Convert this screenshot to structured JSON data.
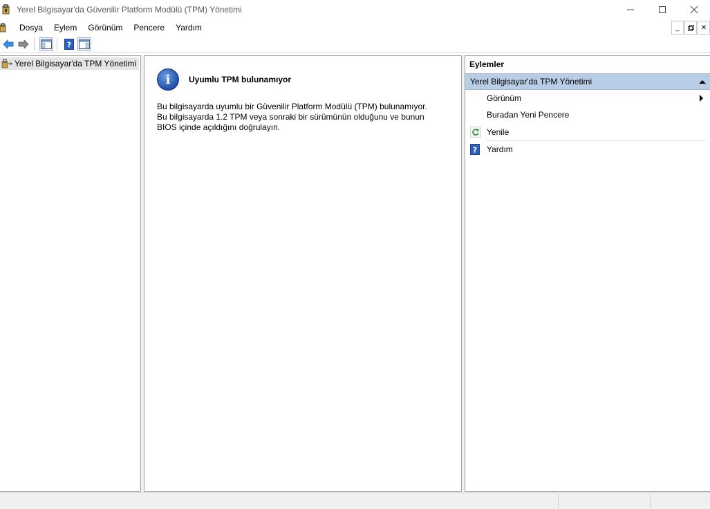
{
  "window": {
    "title": "Yerel Bilgisayar'da Güvenilir Platform Modülü (TPM) Yönetimi",
    "minimize": "—",
    "maximize": "☐",
    "close": "✕"
  },
  "menubar": {
    "items": [
      "Dosya",
      "Eylem",
      "Görünüm",
      "Pencere",
      "Yardım"
    ],
    "mdi_minimize": "_",
    "mdi_restore": "🗗",
    "mdi_close": "✕"
  },
  "toolbar": {
    "icons": [
      "back-arrow-icon",
      "forward-arrow-icon",
      "show-hide-console-tree-icon",
      "help-icon",
      "show-hide-action-pane-icon"
    ]
  },
  "tree": {
    "root_label": "Yerel Bilgisayar'da TPM Yönetimi"
  },
  "center": {
    "heading": "Uyumlu TPM bulunamıyor",
    "body_line1": "Bu bilgisayarda uyumlu bir Güvenilir Platform Modülü (TPM) bulunamıyor.",
    "body_line2": "Bu bilgisayarda 1.2 TPM veya sonraki bir sürümünün olduğunu ve bunun",
    "body_line3": "BIOS içinde açıldığını doğrulayın.",
    "info_glyph": "i"
  },
  "actions": {
    "header": "Eylemler",
    "section_title": "Yerel Bilgisayar'da TPM Yönetimi",
    "items": [
      {
        "label": "Görünüm",
        "icon": "",
        "submenu": true
      },
      {
        "label": "Buradan Yeni Pencere",
        "icon": ""
      },
      {
        "label": "Yenile",
        "icon": "refresh-icon"
      },
      {
        "label": "Yardım",
        "icon": "help-icon"
      }
    ]
  },
  "colors": {
    "accent_selection": "#b9cde6",
    "info_blue": "#1f4fa8"
  }
}
